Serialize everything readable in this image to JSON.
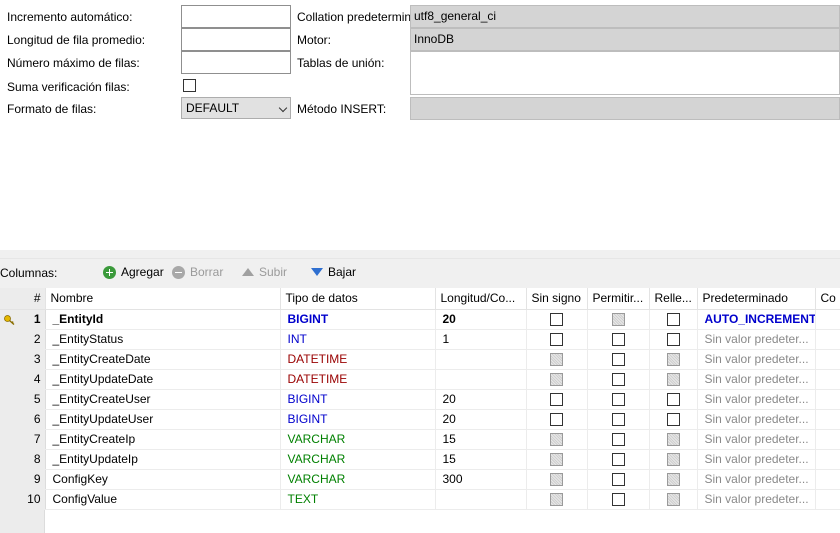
{
  "colors": {
    "bigint": "#0000cc",
    "int": "#0000cc",
    "datetime": "#990000",
    "varchar": "#008000",
    "text": "#008000",
    "accent": "#2f6fd0"
  },
  "form": {
    "auto_increment_label": "Incremento automático:",
    "avg_row_length_label": "Longitud de fila promedio:",
    "max_rows_label": "Número máximo de filas:",
    "checksum_label": "Suma verificación filas:",
    "row_format_label": "Formato de filas:",
    "row_format_value": "DEFAULT",
    "collation_label": "Collation predeterminada:",
    "collation_value": "utf8_general_ci",
    "engine_label": "Motor:",
    "engine_value": "InnoDB",
    "union_tables_label": "Tablas de unión:",
    "insert_method_label": "Método INSERT:"
  },
  "toolbar": {
    "columns_label": "Columnas:",
    "add_label": "Agregar",
    "delete_label": "Borrar",
    "up_label": "Subir",
    "down_label": "Bajar"
  },
  "grid": {
    "headers": [
      "#",
      "Nombre",
      "Tipo de datos",
      "Longitud/Co...",
      "Sin signo",
      "Permitir...",
      "Relle...",
      "Predeterminado",
      "Co"
    ],
    "rows": [
      {
        "num": "1",
        "name": "_EntityId",
        "type": "BIGINT",
        "type_color": "bigint",
        "length": "20",
        "unsigned": "unchecked",
        "allow_null": "disabled",
        "zerofill": "unchecked",
        "default": "AUTO_INCREMENT",
        "default_placeholder": false
      },
      {
        "num": "2",
        "name": "_EntityStatus",
        "type": "INT",
        "type_color": "int",
        "length": "1",
        "unsigned": "unchecked",
        "allow_null": "unchecked",
        "zerofill": "unchecked",
        "default": "Sin valor predeter...",
        "default_placeholder": true
      },
      {
        "num": "3",
        "name": "_EntityCreateDate",
        "type": "DATETIME",
        "type_color": "datetime",
        "length": "",
        "unsigned": "disabled",
        "allow_null": "unchecked",
        "zerofill": "disabled",
        "default": "Sin valor predeter...",
        "default_placeholder": true
      },
      {
        "num": "4",
        "name": "_EntityUpdateDate",
        "type": "DATETIME",
        "type_color": "datetime",
        "length": "",
        "unsigned": "disabled",
        "allow_null": "unchecked",
        "zerofill": "disabled",
        "default": "Sin valor predeter...",
        "default_placeholder": true
      },
      {
        "num": "5",
        "name": "_EntityCreateUser",
        "type": "BIGINT",
        "type_color": "bigint",
        "length": "20",
        "unsigned": "unchecked",
        "allow_null": "unchecked",
        "zerofill": "unchecked",
        "default": "Sin valor predeter...",
        "default_placeholder": true
      },
      {
        "num": "6",
        "name": "_EntityUpdateUser",
        "type": "BIGINT",
        "type_color": "bigint",
        "length": "20",
        "unsigned": "unchecked",
        "allow_null": "unchecked",
        "zerofill": "unchecked",
        "default": "Sin valor predeter...",
        "default_placeholder": true
      },
      {
        "num": "7",
        "name": "_EntityCreateIp",
        "type": "VARCHAR",
        "type_color": "varchar",
        "length": "15",
        "unsigned": "disabled",
        "allow_null": "unchecked",
        "zerofill": "disabled",
        "default": "Sin valor predeter...",
        "default_placeholder": true
      },
      {
        "num": "8",
        "name": "_EntityUpdateIp",
        "type": "VARCHAR",
        "type_color": "varchar",
        "length": "15",
        "unsigned": "disabled",
        "allow_null": "unchecked",
        "zerofill": "disabled",
        "default": "Sin valor predeter...",
        "default_placeholder": true
      },
      {
        "num": "9",
        "name": "ConfigKey",
        "type": "VARCHAR",
        "type_color": "varchar",
        "length": "300",
        "unsigned": "disabled",
        "allow_null": "unchecked",
        "zerofill": "disabled",
        "default": "Sin valor predeter...",
        "default_placeholder": true
      },
      {
        "num": "10",
        "name": "ConfigValue",
        "type": "TEXT",
        "type_color": "text",
        "length": "",
        "unsigned": "disabled",
        "allow_null": "unchecked",
        "zerofill": "disabled",
        "default": "Sin valor predeter...",
        "default_placeholder": true
      }
    ]
  }
}
